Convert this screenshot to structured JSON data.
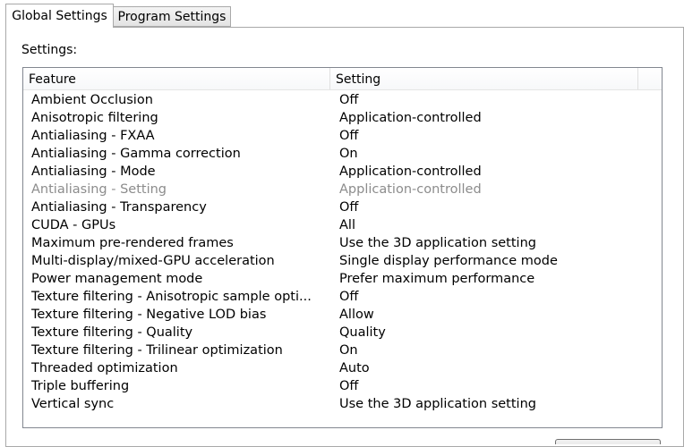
{
  "tabs": [
    {
      "label": "Global Settings",
      "selected": true
    },
    {
      "label": "Program Settings",
      "selected": false
    }
  ],
  "settings_label": "Settings:",
  "table": {
    "columns": {
      "feature": "Feature",
      "setting": "Setting"
    },
    "rows": [
      {
        "feature": "Ambient Occlusion",
        "setting": "Off",
        "disabled": false
      },
      {
        "feature": "Anisotropic filtering",
        "setting": "Application-controlled",
        "disabled": false
      },
      {
        "feature": "Antialiasing - FXAA",
        "setting": "Off",
        "disabled": false
      },
      {
        "feature": "Antialiasing - Gamma correction",
        "setting": "On",
        "disabled": false
      },
      {
        "feature": "Antialiasing - Mode",
        "setting": "Application-controlled",
        "disabled": false
      },
      {
        "feature": "Antialiasing - Setting",
        "setting": "Application-controlled",
        "disabled": true
      },
      {
        "feature": "Antialiasing - Transparency",
        "setting": "Off",
        "disabled": false
      },
      {
        "feature": "CUDA - GPUs",
        "setting": "All",
        "disabled": false
      },
      {
        "feature": "Maximum pre-rendered frames",
        "setting": "Use the 3D application setting",
        "disabled": false
      },
      {
        "feature": "Multi-display/mixed-GPU acceleration",
        "setting": "Single display performance mode",
        "disabled": false
      },
      {
        "feature": "Power management mode",
        "setting": "Prefer maximum performance",
        "disabled": false
      },
      {
        "feature": "Texture filtering - Anisotropic sample opti...",
        "setting": "Off",
        "disabled": false
      },
      {
        "feature": "Texture filtering - Negative LOD bias",
        "setting": "Allow",
        "disabled": false
      },
      {
        "feature": "Texture filtering - Quality",
        "setting": "Quality",
        "disabled": false
      },
      {
        "feature": "Texture filtering - Trilinear optimization",
        "setting": "On",
        "disabled": false
      },
      {
        "feature": "Threaded optimization",
        "setting": "Auto",
        "disabled": false
      },
      {
        "feature": "Triple buffering",
        "setting": "Off",
        "disabled": false
      },
      {
        "feature": "Vertical sync",
        "setting": "Use the 3D application setting",
        "disabled": false
      }
    ]
  },
  "colors": {
    "disabled_text": "#8c8c8c",
    "border": "#a9a9a9",
    "list_border": "#828790"
  }
}
